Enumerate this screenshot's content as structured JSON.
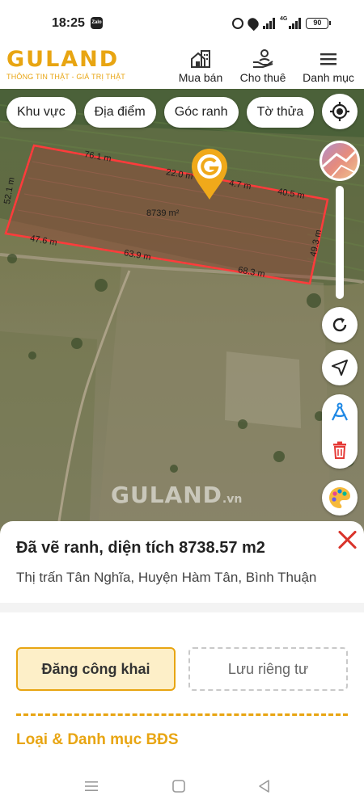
{
  "status_bar": {
    "time": "18:25",
    "zalo": "Zalo",
    "net": "4G",
    "battery": "90"
  },
  "header": {
    "logo": "GULAND",
    "tagline": "THÔNG TIN THẬT - GIÁ TRỊ THẬT",
    "nav": [
      {
        "label": "Mua bán",
        "icon": "house-building-icon"
      },
      {
        "label": "Cho thuê",
        "icon": "hand-person-icon"
      },
      {
        "label": "Danh mục",
        "icon": "menu-icon"
      }
    ]
  },
  "map": {
    "filters": [
      "Khu vực",
      "Địa điểm",
      "Góc ranh",
      "Tờ thửa"
    ],
    "watermark": "GULAND",
    "watermark_suffix": ".vn",
    "plot": {
      "area_label": "8739 m²",
      "edges": [
        "76.1 m",
        "22.0 m",
        "4.7 m",
        "40.5 m",
        "52.1 m",
        "47.6 m",
        "63.9 m",
        "68.3 m",
        "49.3 m"
      ],
      "outline_color": "#ff3b3b"
    },
    "controls": [
      "locate-icon",
      "layers-icon",
      "refresh-icon",
      "navigate-icon",
      "compass-tool-icon",
      "trash-icon",
      "palette-icon"
    ]
  },
  "sheet": {
    "title": "Đã vẽ ranh, diện tích 8738.57 m2",
    "address": "Thị trấn Tân Nghĩa, Huyện Hàm Tân, Bình Thuận",
    "btn_public": "Đăng công khai",
    "btn_private": "Lưu riêng tư",
    "section_title": "Loại & Danh mục BĐS"
  },
  "colors": {
    "brand": "#e8a512",
    "close": "#d9342b"
  }
}
